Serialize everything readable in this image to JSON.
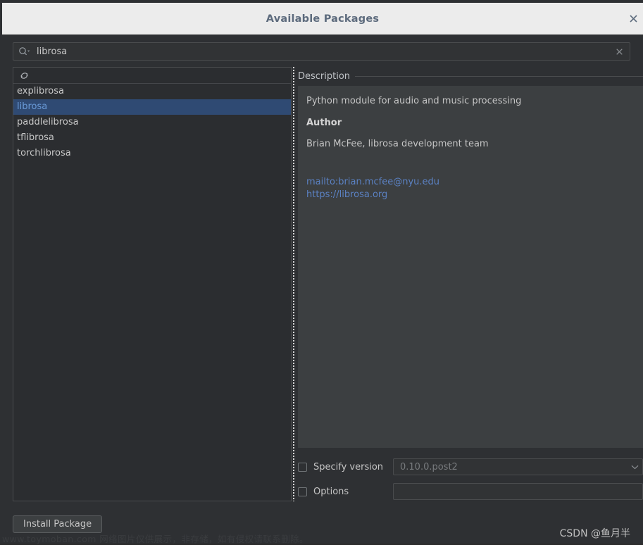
{
  "window": {
    "title": "Available Packages",
    "close_label": "✕"
  },
  "search": {
    "value": "librosa",
    "placeholder": "",
    "icon": "search-icon",
    "clear_label": "×"
  },
  "list_panel": {
    "refresh_icon": "refresh-icon",
    "selected": "librosa",
    "packages": [
      "explibrosa",
      "librosa",
      "paddlelibrosa",
      "tflibrosa",
      "torchlibrosa"
    ]
  },
  "description": {
    "header": "Description",
    "summary": "Python module for audio and music processing",
    "author_label": "Author",
    "author_value": "Brian McFee, librosa development team",
    "links": [
      "mailto:brian.mcfee@nyu.edu",
      "https://librosa.org"
    ]
  },
  "options": {
    "specify_version_label": "Specify version",
    "specify_version_checked": false,
    "version_value": "0.10.0.post2",
    "version_arrow": "chevron-down-icon",
    "options_label": "Options",
    "options_checked": false,
    "options_value": "",
    "options_placeholder": ""
  },
  "actions": {
    "install_label": "Install Package"
  },
  "watermarks": {
    "left": "www.toymoban.com 网络图片仅供展示，非存储，如有侵权请联系删除。",
    "right": "CSDN @鱼月半"
  },
  "colors": {
    "dialog_bg": "#2e3033",
    "titlebar_bg": "#ececec",
    "title_text": "#5d6b7d",
    "panel_bg": "#2b2d30",
    "desc_bg": "#3c3f41",
    "selection_bg": "#2f4a73",
    "selection_fg": "#6a9bd8",
    "link": "#5b82c4",
    "border": "#4a4c4e",
    "text": "#c5c5c5"
  }
}
